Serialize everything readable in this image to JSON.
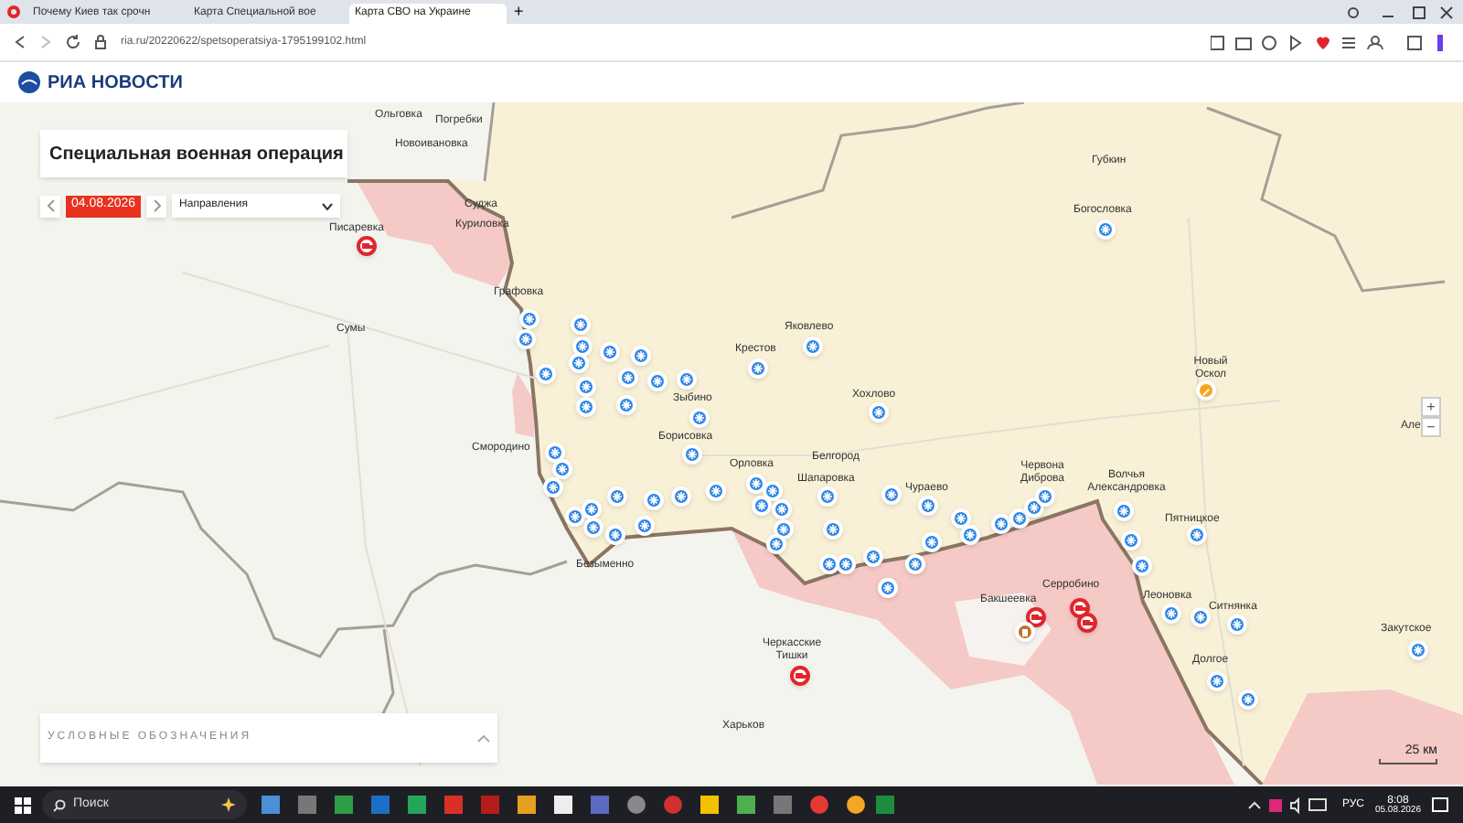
{
  "browser": {
    "tabs": [
      {
        "title": "Почему Киев так срочн",
        "selected": false
      },
      {
        "title": "Карта Специальной вое",
        "selected": false
      },
      {
        "title": "Карта СВО на Украине",
        "selected": true
      }
    ],
    "new_tab": "+",
    "url": "ria.ru/20220622/spetsoperatsiya-1795199102.html"
  },
  "site": {
    "logo_text": "РИА НОВОСТИ"
  },
  "map": {
    "title": "Специальная военная операция",
    "date": "04.08.2026",
    "directions_select": "Направления",
    "labels": [
      "Ольговка",
      "Погребки",
      "Новоивановка",
      "Суджа",
      "Куриловка",
      "Писаревка",
      "Графовка",
      "Сумы",
      "Крестов",
      "Яковлево",
      "Зыбино",
      "Хохлово",
      "Борисовка",
      "Смородино",
      "Губкин",
      "Богословка",
      "Новый Оскол",
      "Але",
      "Белгород",
      "Орловка",
      "Шапаровка",
      "Чураево",
      "Червона Диброва",
      "Волчья Александровка",
      "Пятницкое",
      "Безыменно",
      "Серробино",
      "Бакшеевка",
      "Леоновка",
      "Ситнянка",
      "Черкасские Тишки",
      "Долгое",
      "Закутское",
      "Харьков"
    ],
    "zoom_in": "+",
    "zoom_out": "−",
    "scale": "25 км",
    "legend_title": "УСЛОВНЫЕ ОБОЗНАЧЕНИЯ"
  },
  "taskbar": {
    "search_placeholder": "Поиск",
    "language": "РУС",
    "time": "8:08",
    "date": "05.08.2026"
  }
}
